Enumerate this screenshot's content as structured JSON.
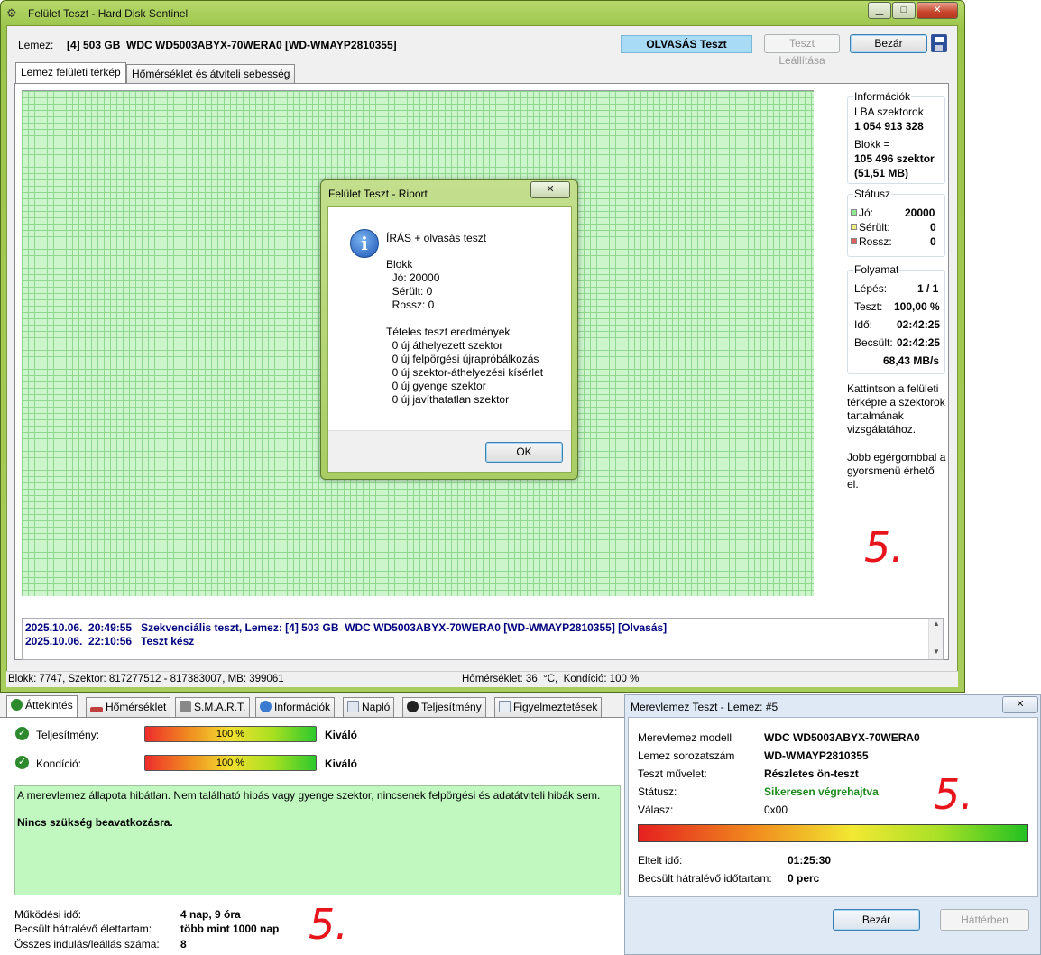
{
  "main": {
    "title": "Felület Teszt - Hard Disk Sentinel",
    "window_buttons": {
      "minimize": "▁",
      "maximize": "□",
      "close": "✕"
    },
    "disk_label": "Lemez:",
    "disk_value": "[4] 503 GB  WDC WD5003ABYX-70WERA0 [WD-WMAYP2810355]",
    "mode_badge": "OLVASÁS Teszt",
    "stop_button": "Teszt Leállítása",
    "close_button": "Bezár",
    "tabs": [
      "Lemez felületi térkép",
      "Hőmérséklet és átviteli sebesség"
    ],
    "info": {
      "title": "Információk",
      "lba_label": "LBA szektorok",
      "lba_value": "1 054 913 328",
      "block_label": "Blokk =",
      "block_value1": "105 496 szektor",
      "block_value2": "(51,51 MB)"
    },
    "status": {
      "title": "Státusz",
      "good_label": "Jó:",
      "good_value": "20000",
      "damaged_label": "Sérült:",
      "damaged_value": "0",
      "bad_label": "Rossz:",
      "bad_value": "0",
      "good_color": "#90e890",
      "damaged_color": "#f0f080",
      "bad_color": "#e06060"
    },
    "progress": {
      "title": "Folyamat",
      "step_label": "Lépés:",
      "step_value": "1 / 1",
      "test_label": "Teszt:",
      "test_value": "100,00 %",
      "time_label": "Idő:",
      "time_value": "02:42:25",
      "est_label": "Becsült:",
      "est_value": "02:42:25",
      "speed": "68,43 MB/s"
    },
    "help1": "Kattintson a felületi térképre a szektorok tartalmának vizsgálatához.",
    "help2": "Jobb egérgombbal a gyorsmenü érhető el.",
    "log": [
      "2025.10.06.  20:49:55   Szekvenciális teszt, Lemez: [4] 503 GB  WDC WD5003ABYX-70WERA0 [WD-WMAYP2810355] [Olvasás]",
      "2025.10.06.  22:10:56   Teszt kész"
    ],
    "statusbar_left": "Blokk: 7747, Szektor: 817277512 - 817383007, MB: 399061",
    "statusbar_right": "Hőmérséklet: 36  °C,  Kondíció: 100 %"
  },
  "riport": {
    "title": "Felület Teszt - Riport",
    "close": "✕",
    "heading": "ÍRÁS + olvasás teszt",
    "block_title": "Blokk",
    "block_lines": [
      "  Jó: 20000",
      "  Sérült: 0",
      "  Rossz: 0"
    ],
    "results_title": "Tételes teszt eredmények",
    "result_lines": [
      "  0 új áthelyezett szektor",
      "  0 új felpörgési újrapróbálkozás",
      "  0 új szektor-áthelyezési kísérlet",
      "  0 új gyenge szektor",
      "  0 új javíthatatlan szektor"
    ],
    "ok_button": "OK"
  },
  "overview": {
    "tabs": [
      "Áttekintés",
      "Hőmérséklet",
      "S.M.A.R.T.",
      "Információk",
      "Napló",
      "Teljesítmény",
      "Figyelmeztetések"
    ],
    "performance_label": "Teljesítmény:",
    "performance_value": "100 %",
    "performance_percent": 100,
    "performance_rating": "Kiváló",
    "condition_label": "Kondíció:",
    "condition_value": "100 %",
    "condition_percent": 100,
    "condition_rating": "Kiváló",
    "health_text": "A merevlemez állapota hibátlan. Nem található hibás vagy gyenge szektor, nincsenek felpörgési és adatátviteli hibák sem.",
    "health_action": "Nincs szükség beavatkozásra.",
    "uptime_label": "Működési idő:",
    "uptime_value": "4 nap, 9 óra",
    "life_label": "Becsült hátralévő élettartam:",
    "life_value": "több mint 1000 nap",
    "starts_label": "Összes indulás/leállás száma:",
    "starts_value": "8"
  },
  "hdtest": {
    "title": "Merevlemez Teszt - Lemez: #5",
    "close": "✕",
    "model_label": "Merevlemez modell",
    "model_value": "WDC WD5003ABYX-70WERA0",
    "serial_label": "Lemez sorozatszám",
    "serial_value": "WD-WMAYP2810355",
    "op_label": "Teszt művelet:",
    "op_value": "Részletes ön-teszt",
    "status_label": "Státusz:",
    "status_value": "Sikeresen végrehajtva",
    "status_color": "#1a8a1a",
    "answer_label": "Válasz:",
    "answer_value": "0x00",
    "progress_percent": 100,
    "elapsed_label": "Eltelt idő:",
    "elapsed_value": "01:25:30",
    "remaining_label": "Becsült hátralévő időtartam:",
    "remaining_value": "0 perc",
    "close_button": "Bezár",
    "background_button": "Háttérben"
  },
  "annotations": [
    "5.",
    "5.",
    "5."
  ]
}
